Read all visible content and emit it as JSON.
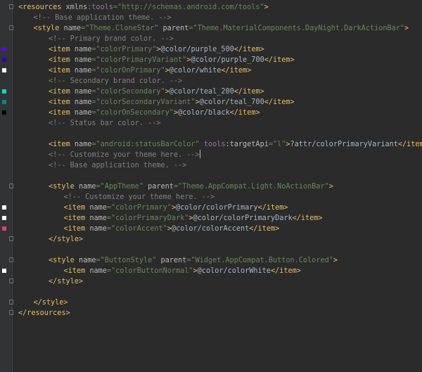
{
  "editor": {
    "lines": [
      {
        "indent": 0,
        "fold": "open",
        "swatch": null,
        "tokens": [
          [
            "<resources ",
            "bracket"
          ],
          [
            "xmlns",
            "attr"
          ],
          [
            ":tools",
            "ns"
          ],
          [
            "=\"http://schemas.android.com/tools\"",
            "val"
          ],
          [
            ">",
            "bracket"
          ]
        ]
      },
      {
        "indent": 1,
        "fold": null,
        "swatch": null,
        "tokens": [
          [
            "<!-- Base application theme. -->",
            "comment"
          ]
        ]
      },
      {
        "indent": 1,
        "fold": "open",
        "swatch": null,
        "tokens": [
          [
            "<style ",
            "bracket"
          ],
          [
            "name",
            "attr"
          ],
          [
            "=\"Theme.CloneStar\" ",
            "val"
          ],
          [
            "parent",
            "attr"
          ],
          [
            "=\"Theme.MaterialComponents.DayNight.DarkActionBar\"",
            "val"
          ],
          [
            ">",
            "bracket"
          ]
        ]
      },
      {
        "indent": 2,
        "fold": null,
        "swatch": null,
        "tokens": [
          [
            "<!-- Primary brand color. -->",
            "comment"
          ]
        ]
      },
      {
        "indent": 2,
        "fold": null,
        "swatch": "#6200ee",
        "tokens": [
          [
            "<item ",
            "bracket"
          ],
          [
            "name",
            "attr"
          ],
          [
            "=\"colorPrimary\"",
            "val"
          ],
          [
            ">",
            "bracket"
          ],
          [
            "@color/purple_500",
            "text"
          ],
          [
            "</item>",
            "bracket"
          ]
        ]
      },
      {
        "indent": 2,
        "fold": null,
        "swatch": "#3700b3",
        "tokens": [
          [
            "<item ",
            "bracket"
          ],
          [
            "name",
            "attr"
          ],
          [
            "=\"colorPrimaryVariant\"",
            "val"
          ],
          [
            ">",
            "bracket"
          ],
          [
            "@color/purple_700",
            "text"
          ],
          [
            "</item>",
            "bracket"
          ]
        ]
      },
      {
        "indent": 2,
        "fold": null,
        "swatch": "#ffffff",
        "tokens": [
          [
            "<item ",
            "bracket"
          ],
          [
            "name",
            "attr"
          ],
          [
            "=\"colorOnPrimary\"",
            "val"
          ],
          [
            ">",
            "bracket"
          ],
          [
            "@color/white",
            "text"
          ],
          [
            "</item>",
            "bracket"
          ]
        ]
      },
      {
        "indent": 2,
        "fold": null,
        "swatch": null,
        "tokens": [
          [
            "<!-- Secondary brand color. -->",
            "comment"
          ]
        ]
      },
      {
        "indent": 2,
        "fold": null,
        "swatch": "#03dac5",
        "tokens": [
          [
            "<item ",
            "bracket"
          ],
          [
            "name",
            "attr"
          ],
          [
            "=\"colorSecondary\"",
            "val"
          ],
          [
            ">",
            "bracket"
          ],
          [
            "@color/teal_200",
            "text"
          ],
          [
            "</item>",
            "bracket"
          ]
        ]
      },
      {
        "indent": 2,
        "fold": null,
        "swatch": "#018786",
        "tokens": [
          [
            "<item ",
            "bracket"
          ],
          [
            "name",
            "attr"
          ],
          [
            "=\"colorSecondaryVariant\"",
            "val"
          ],
          [
            ">",
            "bracket"
          ],
          [
            "@color/teal_700",
            "text"
          ],
          [
            "</item>",
            "bracket"
          ]
        ]
      },
      {
        "indent": 2,
        "fold": null,
        "swatch": "#000000",
        "tokens": [
          [
            "<item ",
            "bracket"
          ],
          [
            "name",
            "attr"
          ],
          [
            "=\"colorOnSecondary\"",
            "val"
          ],
          [
            ">",
            "bracket"
          ],
          [
            "@color/black",
            "text"
          ],
          [
            "</item>",
            "bracket"
          ]
        ]
      },
      {
        "indent": 2,
        "fold": null,
        "swatch": null,
        "tokens": [
          [
            "<!-- Status bar color. -->",
            "comment"
          ]
        ]
      },
      {
        "indent": 0,
        "fold": null,
        "swatch": null,
        "tokens": []
      },
      {
        "indent": 2,
        "fold": null,
        "swatch": null,
        "tokens": [
          [
            "<item ",
            "bracket"
          ],
          [
            "name",
            "attr"
          ],
          [
            "=\"android:statusBarColor\" ",
            "val"
          ],
          [
            "tools",
            "ns"
          ],
          [
            ":targetApi",
            "attr"
          ],
          [
            "=\"l\"",
            "val"
          ],
          [
            ">",
            "bracket"
          ],
          [
            "?attr/colorPrimaryVariant",
            "text"
          ],
          [
            "</item>",
            "bracket"
          ]
        ]
      },
      {
        "indent": 2,
        "fold": null,
        "swatch": null,
        "caret": true,
        "tokens": [
          [
            "<!-- Customize your theme here. -->",
            "comment"
          ]
        ]
      },
      {
        "indent": 2,
        "fold": null,
        "swatch": null,
        "tokens": [
          [
            "<!-- Base application theme. -->",
            "comment"
          ]
        ]
      },
      {
        "indent": 0,
        "fold": null,
        "swatch": null,
        "tokens": []
      },
      {
        "indent": 2,
        "fold": "open",
        "swatch": null,
        "tokens": [
          [
            "<style ",
            "bracket"
          ],
          [
            "name",
            "attr"
          ],
          [
            "=\"AppTheme\" ",
            "val"
          ],
          [
            "parent",
            "attr"
          ],
          [
            "=\"Theme.AppCompat.Light.NoActionBar\"",
            "val"
          ],
          [
            ">",
            "bracket"
          ]
        ]
      },
      {
        "indent": 3,
        "fold": null,
        "swatch": null,
        "tokens": [
          [
            "<!-- Customize your theme here. -->",
            "comment"
          ]
        ]
      },
      {
        "indent": 3,
        "fold": null,
        "swatch": "#ffffff",
        "tokens": [
          [
            "<item ",
            "bracket"
          ],
          [
            "name",
            "attr"
          ],
          [
            "=\"colorPrimary\"",
            "val"
          ],
          [
            ">",
            "bracket"
          ],
          [
            "@color/colorPrimary",
            "text"
          ],
          [
            "</item>",
            "bracket"
          ]
        ]
      },
      {
        "indent": 3,
        "fold": null,
        "swatch": "#ffffff",
        "tokens": [
          [
            "<item ",
            "bracket"
          ],
          [
            "name",
            "attr"
          ],
          [
            "=\"colorPrimaryDark\"",
            "val"
          ],
          [
            ">",
            "bracket"
          ],
          [
            "@color/colorPrimaryDark",
            "text"
          ],
          [
            "</item>",
            "bracket"
          ]
        ]
      },
      {
        "indent": 3,
        "fold": null,
        "swatch": "#d6457a",
        "tokens": [
          [
            "<item ",
            "bracket"
          ],
          [
            "name",
            "attr"
          ],
          [
            "=\"colorAccent\"",
            "val"
          ],
          [
            ">",
            "bracket"
          ],
          [
            "@color/colorAccent",
            "text"
          ],
          [
            "</item>",
            "bracket"
          ]
        ]
      },
      {
        "indent": 2,
        "fold": "close",
        "swatch": null,
        "tokens": [
          [
            "</style>",
            "bracket"
          ]
        ]
      },
      {
        "indent": 0,
        "fold": null,
        "swatch": null,
        "tokens": []
      },
      {
        "indent": 2,
        "fold": "open",
        "swatch": null,
        "tokens": [
          [
            "<style ",
            "bracket"
          ],
          [
            "name",
            "attr"
          ],
          [
            "=\"ButtonStyle\" ",
            "val"
          ],
          [
            "parent",
            "attr"
          ],
          [
            "=\"Widget.AppCompat.Button.Colored\"",
            "val"
          ],
          [
            ">",
            "bracket"
          ]
        ]
      },
      {
        "indent": 3,
        "fold": null,
        "swatch": "#ffffff",
        "tokens": [
          [
            "<item ",
            "bracket"
          ],
          [
            "name",
            "attr"
          ],
          [
            "=\"colorButtonNormal\"",
            "val"
          ],
          [
            ">",
            "bracket"
          ],
          [
            "@color/colorWhite",
            "text"
          ],
          [
            "</item>",
            "bracket"
          ]
        ]
      },
      {
        "indent": 2,
        "fold": "close",
        "swatch": null,
        "tokens": [
          [
            "</style>",
            "bracket"
          ]
        ]
      },
      {
        "indent": 0,
        "fold": null,
        "swatch": null,
        "tokens": []
      },
      {
        "indent": 1,
        "fold": "close",
        "swatch": null,
        "tokens": [
          [
            "</style>",
            "bracket"
          ]
        ]
      },
      {
        "indent": 0,
        "fold": "close",
        "swatch": null,
        "tokens": [
          [
            "</resources>",
            "bracket"
          ]
        ]
      }
    ]
  }
}
